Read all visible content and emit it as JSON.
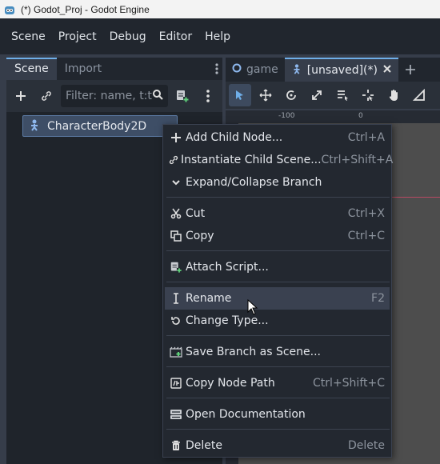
{
  "window": {
    "title": "(*) Godot_Proj - Godot Engine"
  },
  "menubar": {
    "items": [
      "Scene",
      "Project",
      "Debug",
      "Editor",
      "Help"
    ]
  },
  "scene_dock": {
    "tabs": [
      "Scene",
      "Import"
    ],
    "filter_placeholder": "Filter: name, t:t",
    "tree": {
      "root": "CharacterBody2D"
    }
  },
  "editor": {
    "tabs": [
      "game",
      "[unsaved](*)"
    ],
    "ruler": {
      "labels": [
        "-100",
        "0"
      ]
    }
  },
  "context_menu": {
    "items": [
      {
        "label": "Add Child Node...",
        "shortcut": "Ctrl+A",
        "icon": "plus-icon"
      },
      {
        "label": "Instantiate Child Scene...",
        "shortcut": "Ctrl+Shift+A",
        "icon": "link-icon"
      },
      {
        "label": "Expand/Collapse Branch",
        "shortcut": "",
        "icon": "chevron-down-icon"
      },
      {
        "label": "Cut",
        "shortcut": "Ctrl+X",
        "icon": "scissors-icon"
      },
      {
        "label": "Copy",
        "shortcut": "Ctrl+C",
        "icon": "copy-icon"
      },
      {
        "label": "Attach Script...",
        "shortcut": "",
        "icon": "script-add-icon"
      },
      {
        "label": "Rename",
        "shortcut": "F2",
        "icon": "text-cursor-icon"
      },
      {
        "label": "Change Type...",
        "shortcut": "",
        "icon": "rotate-icon"
      },
      {
        "label": "Save Branch as Scene...",
        "shortcut": "",
        "icon": "save-branch-icon"
      },
      {
        "label": "Copy Node Path",
        "shortcut": "Ctrl+Shift+C",
        "icon": "node-path-icon"
      },
      {
        "label": "Open Documentation",
        "shortcut": "",
        "icon": "doc-icon"
      },
      {
        "label": "Delete",
        "shortcut": "Delete",
        "icon": "trash-icon"
      }
    ]
  },
  "colors": {
    "accent": "#6faee8",
    "menu_bg": "#232830",
    "hover": "#3a4150",
    "node_icon": "#8eb8ee"
  }
}
